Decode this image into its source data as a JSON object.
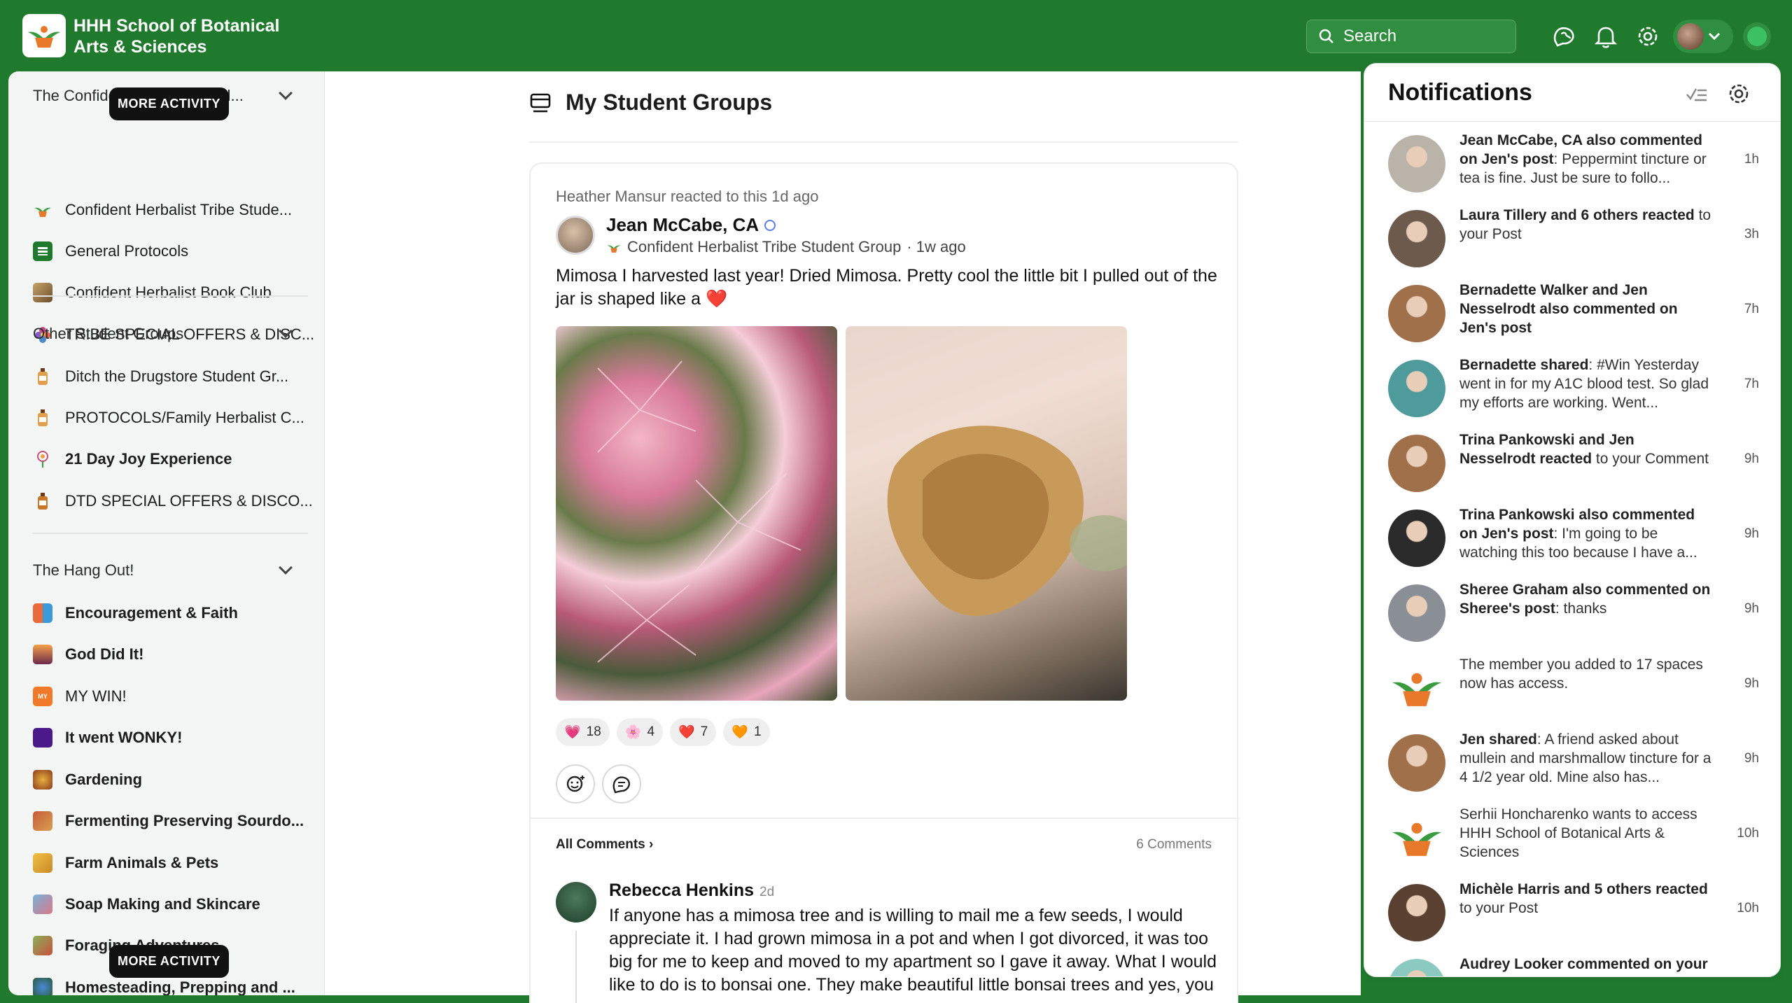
{
  "header": {
    "brand": "HHH School of Botanical Arts & Sciences",
    "search_label": "Search"
  },
  "sidebar": {
    "tooltip": "MORE ACTIVITY",
    "sections": [
      {
        "title": "The Confident Herbalist Stud...",
        "items": [
          {
            "label": "Confident Herbalist Tribe Stude...",
            "bold": false,
            "icon": "herb-logo-icon"
          },
          {
            "label": "General Protocols",
            "bold": false,
            "icon": "protocols-icon"
          },
          {
            "label": "Confident Herbalist Book Club",
            "bold": false,
            "icon": "book-club-icon"
          },
          {
            "label": "TRIBE SPECIAL OFFERS & DISC...",
            "bold": false,
            "icon": "flower-icon"
          }
        ]
      },
      {
        "title": "Other Student Groups",
        "items": [
          {
            "label": "Ditch the Drugstore Student Gr...",
            "bold": false,
            "icon": "bottle-icon"
          },
          {
            "label": "PROTOCOLS/Family Herbalist C...",
            "bold": false,
            "icon": "bottle-icon"
          },
          {
            "label": "21 Day Joy Experience",
            "bold": true,
            "icon": "joy-icon"
          },
          {
            "label": "DTD SPECIAL OFFERS & DISCO...",
            "bold": false,
            "icon": "bottle-icon"
          }
        ]
      },
      {
        "title": "The Hang Out!",
        "items": [
          {
            "label": "Encouragement & Faith",
            "bold": true,
            "icon": "faith-icon"
          },
          {
            "label": "God Did It!",
            "bold": true,
            "icon": "sunset-icon"
          },
          {
            "label": "MY WIN!",
            "bold": false,
            "icon": "win-icon"
          },
          {
            "label": "It went WONKY!",
            "bold": true,
            "icon": "wonky-icon"
          },
          {
            "label": "Gardening",
            "bold": true,
            "icon": "garden-icon"
          },
          {
            "label": "Fermenting Preserving Sourdo...",
            "bold": true,
            "icon": "ferment-icon"
          },
          {
            "label": "Farm Animals & Pets",
            "bold": true,
            "icon": "farm-icon"
          },
          {
            "label": "Soap Making and Skincare",
            "bold": true,
            "icon": "soap-icon"
          },
          {
            "label": "Foraging Adventures",
            "bold": true,
            "icon": "forage-icon"
          },
          {
            "label": "Homesteading, Prepping and ...",
            "bold": true,
            "icon": "homestead-icon"
          }
        ]
      }
    ]
  },
  "main": {
    "title": "My Student Groups",
    "post": {
      "reaction_line": "Heather Mansur reacted to this 1d ago",
      "author": "Jean McCabe, CA",
      "group": "Confident Herbalist Tribe Student Group",
      "time": "· 1w ago",
      "text": "Mimosa I harvested last year! Dried Mimosa. Pretty cool the little bit I pulled out of the jar is shaped like a ❤️",
      "reactions": [
        {
          "emoji": "💗",
          "count": "18"
        },
        {
          "emoji": "🌸",
          "count": "4"
        },
        {
          "emoji": "❤️",
          "count": "7"
        },
        {
          "emoji": "🧡",
          "count": "1"
        }
      ],
      "all_comments": "All Comments",
      "comments_count": "6 Comments",
      "comment": {
        "author": "Rebecca Henkins",
        "time": "2d",
        "text": "If anyone has a mimosa tree and is willing to mail me a few seeds, I would appreciate it. I had grown mimosa in a pot and when I got divorced, it was too big for me to keep and moved to my apartment so I gave it away. What I would like to do is to bonsai one. They make beautiful little bonsai trees and yes, you"
      }
    }
  },
  "notifications": {
    "title": "Notifications",
    "items": [
      {
        "bold": "Jean McCabe, CA also commented on Jen's post",
        "rest": ": Peppermint tincture or tea is fine. Just be sure to follo...",
        "time": "1h",
        "color": "#b9b3aa"
      },
      {
        "bold": "Laura Tillery and 6 others reacted",
        "rest": " to your Post",
        "time": "3h",
        "color": "#6c5a4c"
      },
      {
        "bold": "Bernadette Walker and Jen Nesselrodt also commented on Jen's post",
        "rest": "",
        "time": "7h",
        "color": "#a0704a"
      },
      {
        "bold": "Bernadette shared",
        "rest": ": #Win Yesterday went in for my A1C blood test. So glad my efforts are working. Went...",
        "time": "7h",
        "color": "#4f9a9a"
      },
      {
        "bold": "Trina Pankowski and Jen Nesselrodt reacted",
        "rest": " to your Comment",
        "time": "9h",
        "color": "#a0704a"
      },
      {
        "bold": "Trina Pankowski also commented on Jen's post",
        "rest": ": I'm going to be watching this too because I have a...",
        "time": "9h",
        "color": "#2a2a2a"
      },
      {
        "bold": "Sheree Graham also commented on Sheree's post",
        "rest": ": thanks",
        "time": "9h",
        "color": "#8a8f96"
      },
      {
        "bold": "",
        "rest": "The member you added to 17 spaces now has access.",
        "time": "9h",
        "color": "logo"
      },
      {
        "bold": "Jen shared",
        "rest": ": A friend asked about mullein and marshmallow tincture for a 4 1/2 year old. Mine also has...",
        "time": "9h",
        "color": "#a0704a"
      },
      {
        "bold": "",
        "rest": "Serhii Honcharenko wants to access HHH School of Botanical Arts & Sciences",
        "time": "10h",
        "color": "logo"
      },
      {
        "bold": "Michèle Harris and 5 others reacted",
        "rest": " to your Post",
        "time": "10h",
        "color": "#5a4030"
      },
      {
        "bold": "Audrey Looker commented on your",
        "rest": "",
        "time": "",
        "color": "#8cc9c0"
      }
    ]
  }
}
